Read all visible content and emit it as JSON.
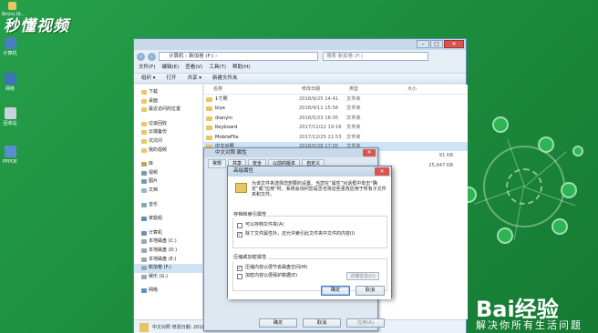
{
  "watermark": "秒懂视频",
  "desktop_icons": [
    {
      "label": "8mini.tlt..."
    },
    {
      "label": "计算机"
    },
    {
      "label": "网络"
    },
    {
      "label": "回收站"
    },
    {
      "label": "PPPOE"
    }
  ],
  "brand": {
    "logo": "Bai经验",
    "slogan": "解决你所有生活问题"
  },
  "explorer": {
    "address": "计算机 › 新加卷 (F:) ›",
    "search_placeholder": "搜索 新加卷 (F:)",
    "menu": [
      "文件(F)",
      "编辑(E)",
      "查看(V)",
      "工具(T)",
      "帮助(H)"
    ],
    "toolbar": [
      "组织 ▾",
      "打开",
      "共享 ▾",
      "新建文件夹"
    ],
    "nav": [
      "下载",
      "桌面",
      "最近访问的位置",
      "",
      "垃圾回收",
      "云端备份",
      "坑坑问",
      "我的视频",
      "",
      "库",
      "视频",
      "图片",
      "文档",
      "",
      "音乐",
      "",
      "家庭组",
      "",
      "计算机",
      "本地磁盘 (C:)",
      "本地磁盘 (D:)",
      "本地磁盘 (E:)",
      "新加卷 (F:)",
      "娱乐 (G:)",
      "",
      "网络"
    ],
    "columns": [
      "名称",
      "修改日期",
      "类型",
      "大小"
    ],
    "files": [
      {
        "name": "1寸照",
        "date": "2018/9/25 14:41",
        "type": "文件夹",
        "size": ""
      },
      {
        "name": "biye",
        "date": "2018/9/11 15:56",
        "type": "文件夹",
        "size": ""
      },
      {
        "name": "dianyin",
        "date": "2018/5/23 16:05",
        "type": "文件夹",
        "size": ""
      },
      {
        "name": "Keyboard",
        "date": "2017/11/22 19:16",
        "type": "文件夹",
        "size": ""
      },
      {
        "name": "MobileFile",
        "date": "2017/12/25 21:53",
        "type": "文件夹",
        "size": ""
      },
      {
        "name": "中文对照",
        "date": "2018/0/28 17:05",
        "type": "文件夹",
        "size": ""
      },
      {
        "name": "",
        "date": "",
        "type": "",
        "size": "91 KB"
      },
      {
        "name": "",
        "date": "",
        "type": "",
        "size": "25,647 KB"
      }
    ],
    "status": "中文对照   修改日期: 2018"
  },
  "properties_dialog": {
    "title": "中文对照 属性",
    "tabs": [
      "常规",
      "共享",
      "安全",
      "以前的版本",
      "自定义"
    ],
    "buttons": [
      "确定",
      "取消",
      "应用(A)"
    ]
  },
  "advanced_dialog": {
    "title": "高级属性",
    "description": "为该文件夹选择您想要的设置。当您在“属性”对话框中单击“确定”或“应用”时，系统会询问您是否也将这些更改应用于所有子文件夹和文件。",
    "group1": "存档和索引属性",
    "opt1": "可以存档文件夹(A)",
    "opt2": "除了文件属性外，还允许索引此文件夹中文件的内容(I)",
    "group2": "压缩或加密属性",
    "opt3": "压缩内容以便节省磁盘空间(M)",
    "opt4": "加密内容以便保护数据(E)",
    "details_button": "详细信息(D)",
    "ok": "确定",
    "cancel": "取消"
  },
  "colors": {
    "desktop_green": "#1f8a3d",
    "close_red": "#d9534f",
    "selection": "#cfe3f7"
  }
}
